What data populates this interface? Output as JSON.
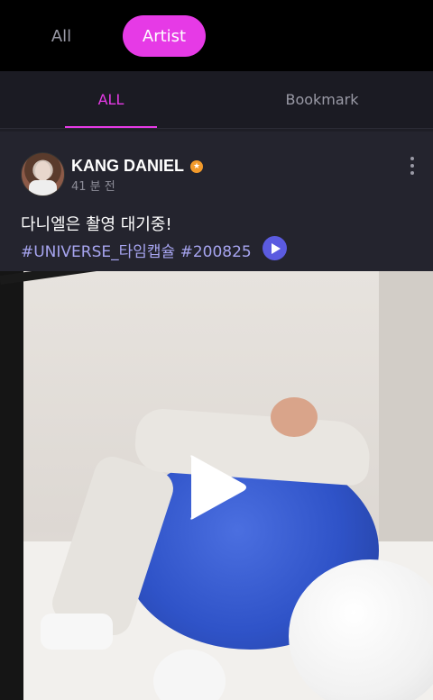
{
  "top_tabs": {
    "all": "All",
    "artist": "Artist"
  },
  "sub_tabs": {
    "all": "ALL",
    "bookmark": "Bookmark"
  },
  "post": {
    "author": "KANG DANIEL",
    "time": "41 분 전",
    "caption": "다니엘은 촬영 대기중!",
    "hashtags": "#UNIVERSE_타임캡슐 #200825",
    "icons": {
      "verified": "star-badge-icon",
      "more": "more-vertical-icon",
      "play": "play-icon"
    },
    "colors": {
      "accent": "#e63ae6",
      "hashtag": "#a6a4ef",
      "play_small_bg": "#5b5be0"
    }
  }
}
